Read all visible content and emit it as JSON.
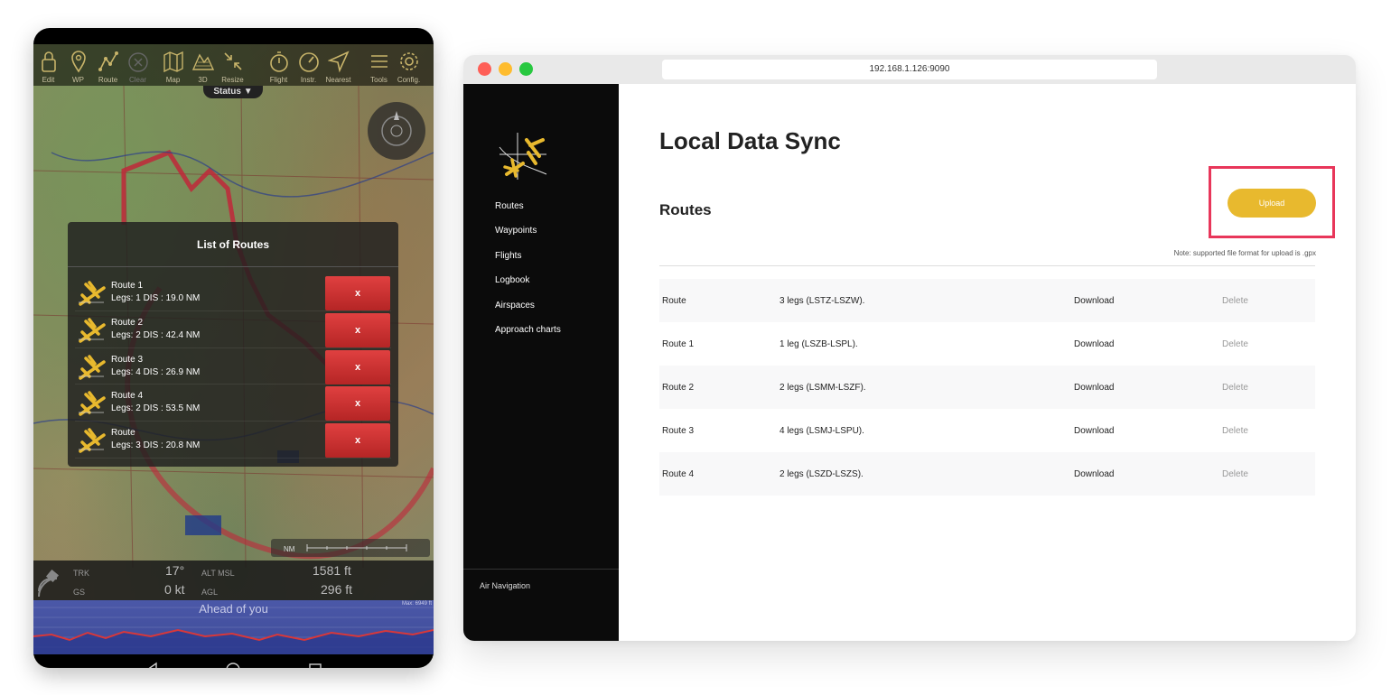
{
  "tablet": {
    "toolbar": [
      {
        "label": "Edit",
        "icon": "lock-icon",
        "enabled": true
      },
      {
        "label": "WP",
        "icon": "pin-icon",
        "enabled": true
      },
      {
        "label": "Route",
        "icon": "route-icon",
        "enabled": true
      },
      {
        "label": "Clear",
        "icon": "clear-icon",
        "enabled": false
      },
      {
        "label": "Map",
        "icon": "map-icon",
        "enabled": true
      },
      {
        "label": "3D",
        "icon": "terrain-icon",
        "enabled": true
      },
      {
        "label": "Resize",
        "icon": "resize-icon",
        "enabled": true
      },
      {
        "label": "Flight",
        "icon": "stopwatch-icon",
        "enabled": true
      },
      {
        "label": "Instr.",
        "icon": "gauge-icon",
        "enabled": true
      },
      {
        "label": "Nearest",
        "icon": "nearest-icon",
        "enabled": true
      },
      {
        "label": "Tools",
        "icon": "menu-icon",
        "enabled": true
      },
      {
        "label": "Config.",
        "icon": "gear-icon",
        "enabled": true
      }
    ],
    "status_tab": "Status ▼",
    "dialog": {
      "title": "List of Routes",
      "delete_label": "x",
      "routes": [
        {
          "name": "Route 1",
          "info": "Legs:  1   DIS :  19.0 NM"
        },
        {
          "name": "Route 2",
          "info": "Legs:  2   DIS :  42.4 NM"
        },
        {
          "name": "Route 3",
          "info": "Legs:  4   DIS :  26.9 NM"
        },
        {
          "name": "Route 4",
          "info": "Legs:  2   DIS :  53.5 NM"
        },
        {
          "name": "Route",
          "info": "Legs:  3   DIS :  20.8 NM"
        }
      ]
    },
    "scale_unit": "NM",
    "instruments": {
      "trk_label": "TRK",
      "trk_value": "17°",
      "gs_label": "GS",
      "gs_value": "0 kt",
      "alt_label": "ALT MSL",
      "alt_value": "1581 ft",
      "agl_label": "AGL",
      "agl_value": "296 ft"
    },
    "profile": {
      "title": "Ahead of you",
      "max": "Max: 6949 ft"
    }
  },
  "browser": {
    "url": "192.168.1.126:9090",
    "traffic_lights": {
      "close": "#fe5f57",
      "minimize": "#febc2e",
      "maximize": "#28c840"
    },
    "sidebar": {
      "nav": [
        "Routes",
        "Waypoints",
        "Flights",
        "Logbook",
        "Airspaces",
        "Approach charts"
      ],
      "footer": "Air Navigation"
    },
    "page_title": "Local Data Sync",
    "section_title": "Routes",
    "upload_label": "Upload",
    "upload_color": "#e8b92e",
    "highlight_color": "#e8365a",
    "note": "Note: supported file format for upload is .gpx",
    "rows": [
      {
        "name": "Route",
        "legs": "3 legs (LSTZ-LSZW).",
        "download": "Download",
        "delete": "Delete"
      },
      {
        "name": "Route 1",
        "legs": "1 leg (LSZB-LSPL).",
        "download": "Download",
        "delete": "Delete"
      },
      {
        "name": "Route 2",
        "legs": "2 legs (LSMM-LSZF).",
        "download": "Download",
        "delete": "Delete"
      },
      {
        "name": "Route 3",
        "legs": "4 legs (LSMJ-LSPU).",
        "download": "Download",
        "delete": "Delete"
      },
      {
        "name": "Route 4",
        "legs": "2 legs (LSZD-LSZS).",
        "download": "Download",
        "delete": "Delete"
      }
    ]
  }
}
